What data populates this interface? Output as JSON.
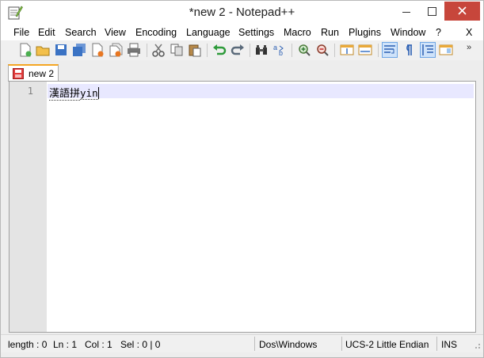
{
  "window": {
    "title": "*new  2 - Notepad++",
    "app_icon": "notepad-plus-plus-icon"
  },
  "menu": {
    "items": [
      "File",
      "Edit",
      "Search",
      "View",
      "Encoding",
      "Language",
      "Settings",
      "Macro",
      "Run",
      "Plugins",
      "Window",
      "?"
    ],
    "close_label": "X"
  },
  "toolbar": {
    "icons": [
      "new-file-icon",
      "open-file-icon",
      "save-icon",
      "save-all-icon",
      "close-icon",
      "close-all-icon",
      "print-icon",
      "cut-icon",
      "copy-icon",
      "paste-icon",
      "undo-icon",
      "redo-icon",
      "find-icon",
      "replace-icon",
      "zoom-in-icon",
      "zoom-out-icon",
      "sync-vertical-icon",
      "sync-horizontal-icon",
      "word-wrap-icon",
      "show-all-characters-icon",
      "indent-guide-icon",
      "document-map-icon"
    ],
    "overflow": "»"
  },
  "tabs": [
    {
      "label": "new  2",
      "icon": "unsaved-document-icon",
      "active": true
    }
  ],
  "editor": {
    "line_number": "1",
    "text_cjk": "漢語拼",
    "text_latin": "yin"
  },
  "status": {
    "length": "length : 0",
    "ln": "Ln : 1",
    "col": "Col : 1",
    "sel": "Sel : 0 | 0",
    "eol": "Dos\\Windows",
    "encoding": "UCS-2 Little Endian",
    "mode": "INS"
  },
  "colors": {
    "tab_accent": "#f5a623",
    "current_line": "#e8e8ff",
    "gutter": "#e4e4e4",
    "close_button": "#c7463b"
  }
}
